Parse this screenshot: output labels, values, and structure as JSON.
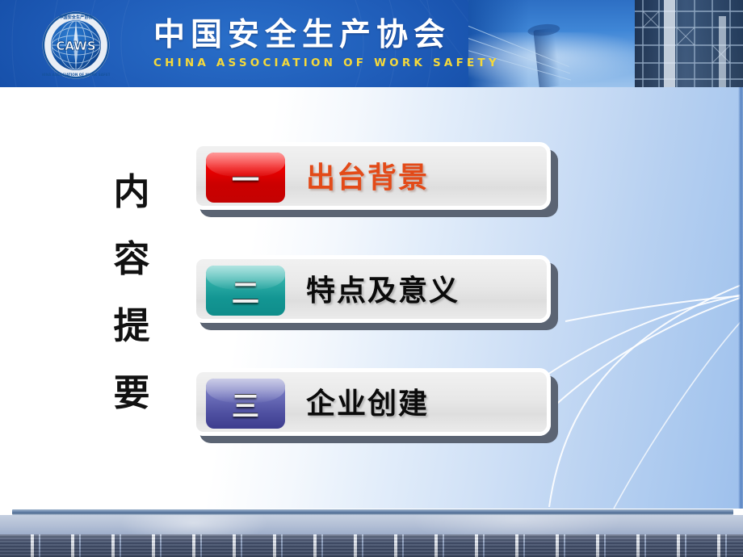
{
  "header": {
    "logo_alt": "caws-emblem",
    "logo_acronym": "CAWS",
    "title_cn": "中国安全生产协会",
    "title_en": "CHINA ASSOCIATION OF WORK SAFETY",
    "banner_color": "#1f5cb8",
    "title_color": "#ffffff",
    "subtitle_color": "#f5d93a"
  },
  "side_label": {
    "text": "内容提要",
    "chars": [
      "内",
      "容",
      "提",
      "要"
    ],
    "color": "#111111"
  },
  "agenda": {
    "items": [
      {
        "numeral": "一",
        "label": "出台背景",
        "badge_color": "#cc0000",
        "label_color": "#e34a18"
      },
      {
        "numeral": "二",
        "label": "特点及意义",
        "badge_color": "#139693",
        "label_color": "#0b0b0b"
      },
      {
        "numeral": "三",
        "label": "企业创建",
        "badge_color": "#4e4fa0",
        "label_color": "#0b0b0b"
      }
    ]
  },
  "theme": {
    "background_left": "#ffffff",
    "background_right": "#9ec0ec",
    "box_fill": "#e8e8e8",
    "box_border": "#ffffff",
    "box_shadow": "#5b6473",
    "footer_rule": "#4f6b91",
    "footer_band": "#93a5c4"
  }
}
